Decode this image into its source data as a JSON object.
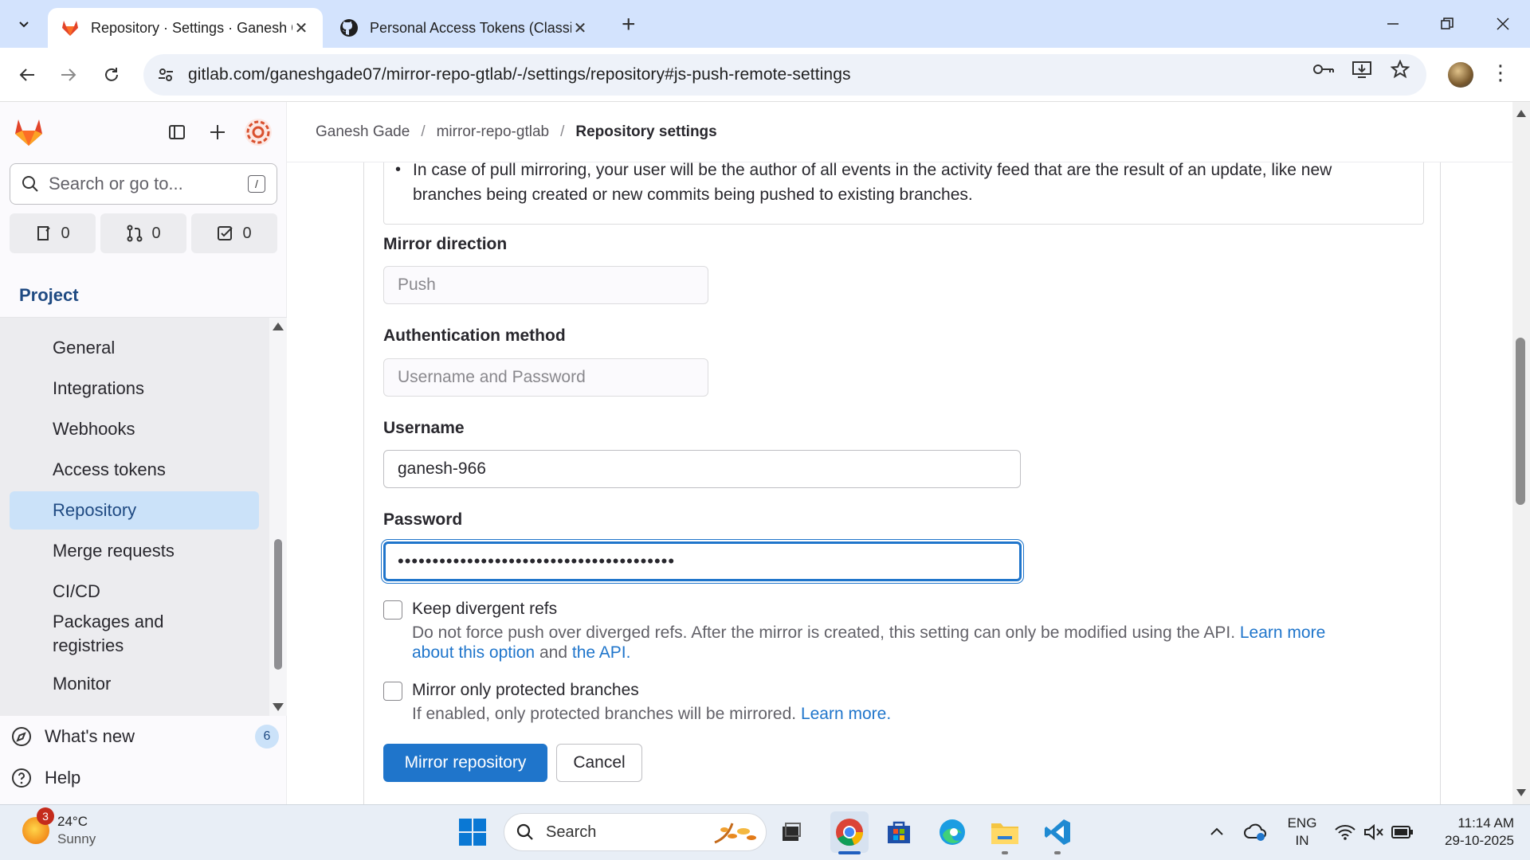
{
  "browser": {
    "tabs": [
      {
        "title": "Repository · Settings · Ganesh G",
        "active": true
      },
      {
        "title": "Personal Access Tokens (Classic",
        "active": false
      }
    ],
    "url": "gitlab.com/ganeshgade07/mirror-repo-gtlab/-/settings/repository#js-push-remote-settings"
  },
  "sidebar": {
    "search_placeholder": "Search or go to...",
    "search_shortcut": "/",
    "counters": {
      "issues": "0",
      "merge_requests": "0",
      "todos": "0"
    },
    "section_title": "Project",
    "items": [
      {
        "label": "General"
      },
      {
        "label": "Integrations"
      },
      {
        "label": "Webhooks"
      },
      {
        "label": "Access tokens"
      },
      {
        "label": "Repository",
        "active": true
      },
      {
        "label": "Merge requests"
      },
      {
        "label": "CI/CD"
      },
      {
        "label": "Packages and registries"
      },
      {
        "label": "Monitor"
      }
    ],
    "whats_new": {
      "label": "What's new",
      "badge": "6"
    },
    "help": {
      "label": "Help"
    }
  },
  "breadcrumb": {
    "items": [
      "Ganesh Gade",
      "mirror-repo-gtlab"
    ],
    "current": "Repository settings"
  },
  "form": {
    "info_bullet": "In case of pull mirroring, your user will be the author of all events in the activity feed that are the result of an update, like new branches being created or new commits being pushed to existing branches.",
    "mirror_direction": {
      "label": "Mirror direction",
      "value": "Push"
    },
    "auth_method": {
      "label": "Authentication method",
      "value": "Username and Password"
    },
    "username": {
      "label": "Username",
      "value": "ganesh-966"
    },
    "password": {
      "label": "Password",
      "value": "••••••••••••••••••••••••••••••••••••••••"
    },
    "keep_divergent": {
      "label": "Keep divergent refs",
      "checked": false,
      "help_text": "Do not force push over diverged refs. After the mirror is created, this setting can only be modified using the API.",
      "link1_a": "Learn more",
      "link1_b": "about this option",
      "and": "and",
      "link2": "the API."
    },
    "protected_only": {
      "label": "Mirror only protected branches",
      "checked": false,
      "help_text": "If enabled, only protected branches will be mirrored.",
      "link": "Learn more."
    },
    "submit_label": "Mirror repository",
    "cancel_label": "Cancel"
  },
  "taskbar": {
    "weather": {
      "temp": "24°C",
      "condition": "Sunny",
      "notifications": "3"
    },
    "search_placeholder": "Search",
    "language": {
      "line1": "ENG",
      "line2": "IN"
    },
    "time": "11:14 AM",
    "date": "29-10-2025"
  },
  "colors": {
    "accent": "#1f75cb",
    "sidebar_active": "#cbe2f9",
    "gitlab_orange": "#e24329"
  }
}
